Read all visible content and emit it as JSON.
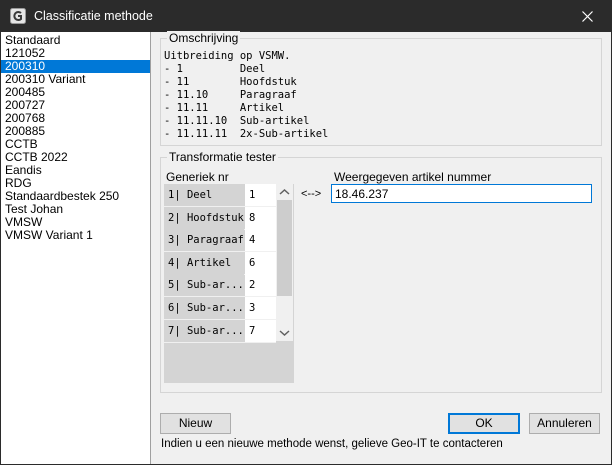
{
  "window": {
    "title": "Classificatie methode"
  },
  "methods": {
    "items": [
      "Standaard",
      "121052",
      "200310",
      "200310 Variant",
      "200485",
      "200727",
      "200768",
      "200885",
      "CCTB",
      "CCTB 2022",
      "Eandis",
      "RDG",
      "Standaardbestek 250",
      "Test Johan",
      "VMSW",
      "VMSW Variant 1"
    ],
    "selected": "200310"
  },
  "description": {
    "legend": "Omschrijving",
    "lines": [
      "Uitbreiding op VSMW.",
      "- 1         Deel",
      "- 11        Hoofdstuk",
      "- 11.10     Paragraaf",
      "- 11.11     Artikel",
      "- 11.11.10  Sub-artikel",
      "- 11.11.11  2x-Sub-artikel"
    ]
  },
  "tester": {
    "legend": "Transformatie tester",
    "generic_label": "Generiek nr",
    "rows": [
      {
        "header": "1| Deel",
        "value": "1"
      },
      {
        "header": "2| Hoofdstuk",
        "value": "8"
      },
      {
        "header": "3| Paragraaf",
        "value": "4"
      },
      {
        "header": "4| Artikel",
        "value": "6"
      },
      {
        "header": "5| Sub-ar...",
        "value": "2"
      },
      {
        "header": "6| Sub-ar...",
        "value": "3"
      },
      {
        "header": "7| Sub-ar...",
        "value": "7"
      }
    ],
    "arrow": "<-->",
    "displayed_label": "Weergegeven artikel nummer",
    "displayed_value": "18.46.237"
  },
  "buttons": {
    "new": "Nieuw",
    "ok": "OK",
    "cancel": "Annuleren"
  },
  "footer": {
    "note": "Indien u een nieuwe methode wenst, gelieve Geo-IT te contacteren"
  },
  "colors": {
    "selection": "#0078d7",
    "titlebar": "#2b2b2b"
  }
}
